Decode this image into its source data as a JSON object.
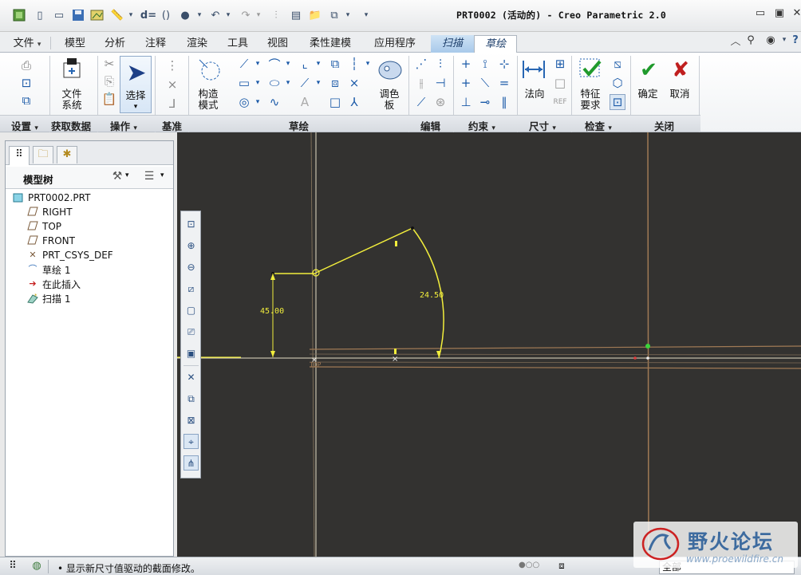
{
  "window": {
    "title": "PRT0002 (活动的) - Creo Parametric 2.0"
  },
  "tabs": [
    {
      "label": "文件",
      "has_menu": true
    },
    {
      "label": "模型"
    },
    {
      "label": "分析"
    },
    {
      "label": "注释"
    },
    {
      "label": "渲染"
    },
    {
      "label": "工具"
    },
    {
      "label": "视图"
    },
    {
      "label": "柔性建模"
    },
    {
      "label": "应用程序"
    },
    {
      "label": "扫描",
      "contextual": true
    },
    {
      "label": "草绘",
      "selected": true
    }
  ],
  "ribbon": {
    "buttons": {
      "file_system": "文件\n系统",
      "select": "选择",
      "construction_mode": "构造\n模式",
      "palette": "调色\n板",
      "normal": "法向",
      "feature_req": "特征\n要求",
      "ok": "确定",
      "cancel": "取消"
    },
    "groups": [
      {
        "label": "设置",
        "has_menu": true
      },
      {
        "label": "获取数据"
      },
      {
        "label": "操作",
        "has_menu": true
      },
      {
        "label": "基准"
      },
      {
        "label": "草绘"
      },
      {
        "label": "编辑"
      },
      {
        "label": "约束",
        "has_menu": true
      },
      {
        "label": "尺寸",
        "has_menu": true
      },
      {
        "label": "检查",
        "has_menu": true
      },
      {
        "label": "关闭"
      }
    ]
  },
  "model_tree": {
    "title": "模型树",
    "items": [
      {
        "label": "PRT0002.PRT",
        "icon": "part-icon",
        "indent": 0
      },
      {
        "label": "RIGHT",
        "icon": "datum-plane-icon",
        "indent": 1
      },
      {
        "label": "TOP",
        "icon": "datum-plane-icon",
        "indent": 1
      },
      {
        "label": "FRONT",
        "icon": "datum-plane-icon",
        "indent": 1
      },
      {
        "label": "PRT_CSYS_DEF",
        "icon": "csys-icon",
        "indent": 1
      },
      {
        "label": "草绘 1",
        "icon": "sketch-icon",
        "indent": 1
      },
      {
        "label": "在此插入",
        "icon": "insert-arrow-icon",
        "indent": 1
      },
      {
        "label": "扫描 1",
        "icon": "sweep-icon",
        "indent": 1
      }
    ]
  },
  "sketch": {
    "dim_vertical": "45.00",
    "dim_arc": "24.50",
    "plane_label": "TOP",
    "colors": {
      "background": "#333230",
      "geometry": "#f2ee3c",
      "reference": "#d9cda8",
      "datum": "#a07a55"
    }
  },
  "status": {
    "message": "显示新尺寸值驱动的截面修改。",
    "filter": "全部"
  },
  "watermark": {
    "title": "野火论坛",
    "url": "www.proewildfire.cn"
  }
}
